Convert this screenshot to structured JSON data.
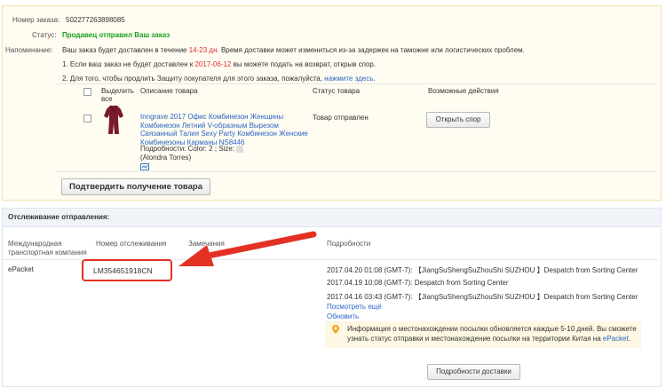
{
  "order": {
    "number_label": "Номер заказа:",
    "number_value": "502277263898085",
    "status_label": "Статус:",
    "status_value": "Продавец отправил Ваш заказ",
    "reminder_label": "Напоминание:",
    "reminder_prefix": "Ваш заказ будет доставлен в течение ",
    "reminder_days": "14-23 дн.",
    "reminder_suffix": " Время доставки может измениться из-за задержек на таможне или логистических проблем.",
    "note1_prefix": "1. Если ваш заказ не будет доставлен к ",
    "note1_date": "2017-06-12",
    "note1_suffix": " вы можете подать на возврат, открыв спор.",
    "note2_prefix": "2. Для того, чтобы продлить Защиту покупателя для этого заказа, пожалуйста, ",
    "note2_link": "нажмите здесь",
    "note2_suffix": "."
  },
  "products_table": {
    "headers": {
      "select_all_line1": "Выделить",
      "select_all_line2": "все",
      "description": "Описание товара",
      "status": "Статус товара",
      "actions": "Возможные действия"
    },
    "item": {
      "title_line1": "Inngrave 2017 Офис Комбинезон Женщины",
      "title_line2": "Комбинезон Летний V-образным Вырезом",
      "title_line3": "Связанный Талия Sexy Party Комбинезон Женские",
      "title_line4": "Комбинезоны Карманы NS8446",
      "details": "Подробности: Color: 2   ; Size: ",
      "details_line2": "(Alondra Torres)",
      "status": "Товар отправлен",
      "action_button": "Открыть спор"
    },
    "confirm_button": "Подтвердить получение товара"
  },
  "tracking": {
    "title": "Отслеживание отправления:",
    "headers": {
      "carrier_line1": "Международная",
      "carrier_line2": "транспортная компания",
      "tracking_number": "Номер отслеживания",
      "remarks": "Замечания",
      "details": "Подробности"
    },
    "carrier": "ePacket",
    "tracking_number": "LM354651918CN",
    "events": [
      "2017.04.20 01:08 (GMT-7): 【JiangSuShengSuZhouShi SUZHOU 】Despatch from Sorting Center",
      "2017.04.19 10:08 (GMT-7): Despatch from Sorting Center",
      "2017.04.16 03:43 (GMT-7): 【JiangSuShengSuZhouShi SUZHOU 】Despatch from Sorting Center"
    ],
    "see_more": "Посмотреть ещё",
    "refresh": "Обновить",
    "info_line1": "Информация о местонахождении посылки обновляется каждые 5-10 дней. Вы сможете",
    "info_line2_prefix": "узнать статус отправки и местонахождение посылки на территории Китая на ",
    "info_line2_link": "ePacket",
    "info_line2_suffix": ".",
    "details_button": "Подробности доставки"
  },
  "colors": {
    "accent_red": "#e33224",
    "status_green": "#1aa01a",
    "link_blue": "#2a64c5"
  }
}
